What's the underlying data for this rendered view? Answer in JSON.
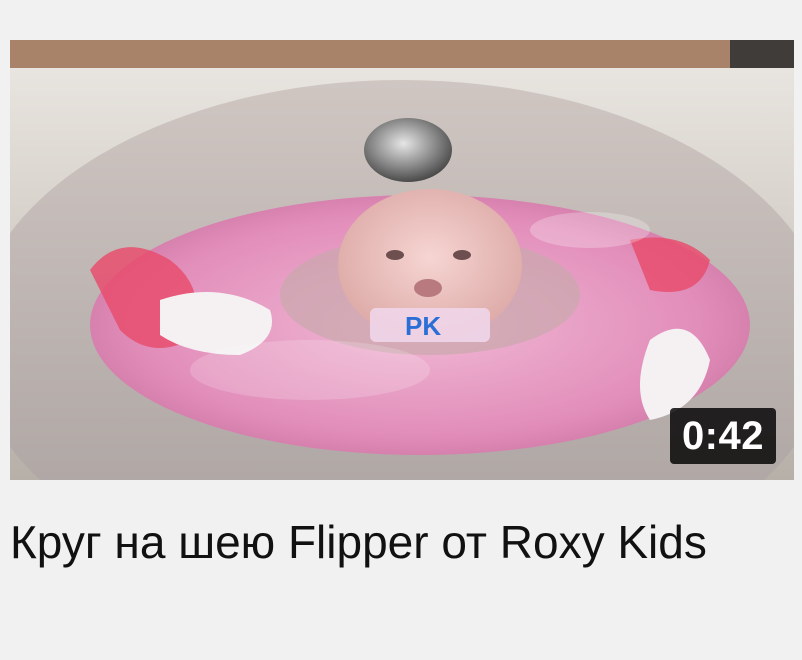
{
  "video": {
    "title": "Круг на шею Flipper от Roxy Kids",
    "duration": "0:42",
    "thumbnail_overlay_text": "PK"
  },
  "colors": {
    "page_background": "#f1f1f1",
    "title_text": "#111111",
    "duration_badge_bg": "#000000",
    "duration_badge_text": "#ffffff"
  }
}
